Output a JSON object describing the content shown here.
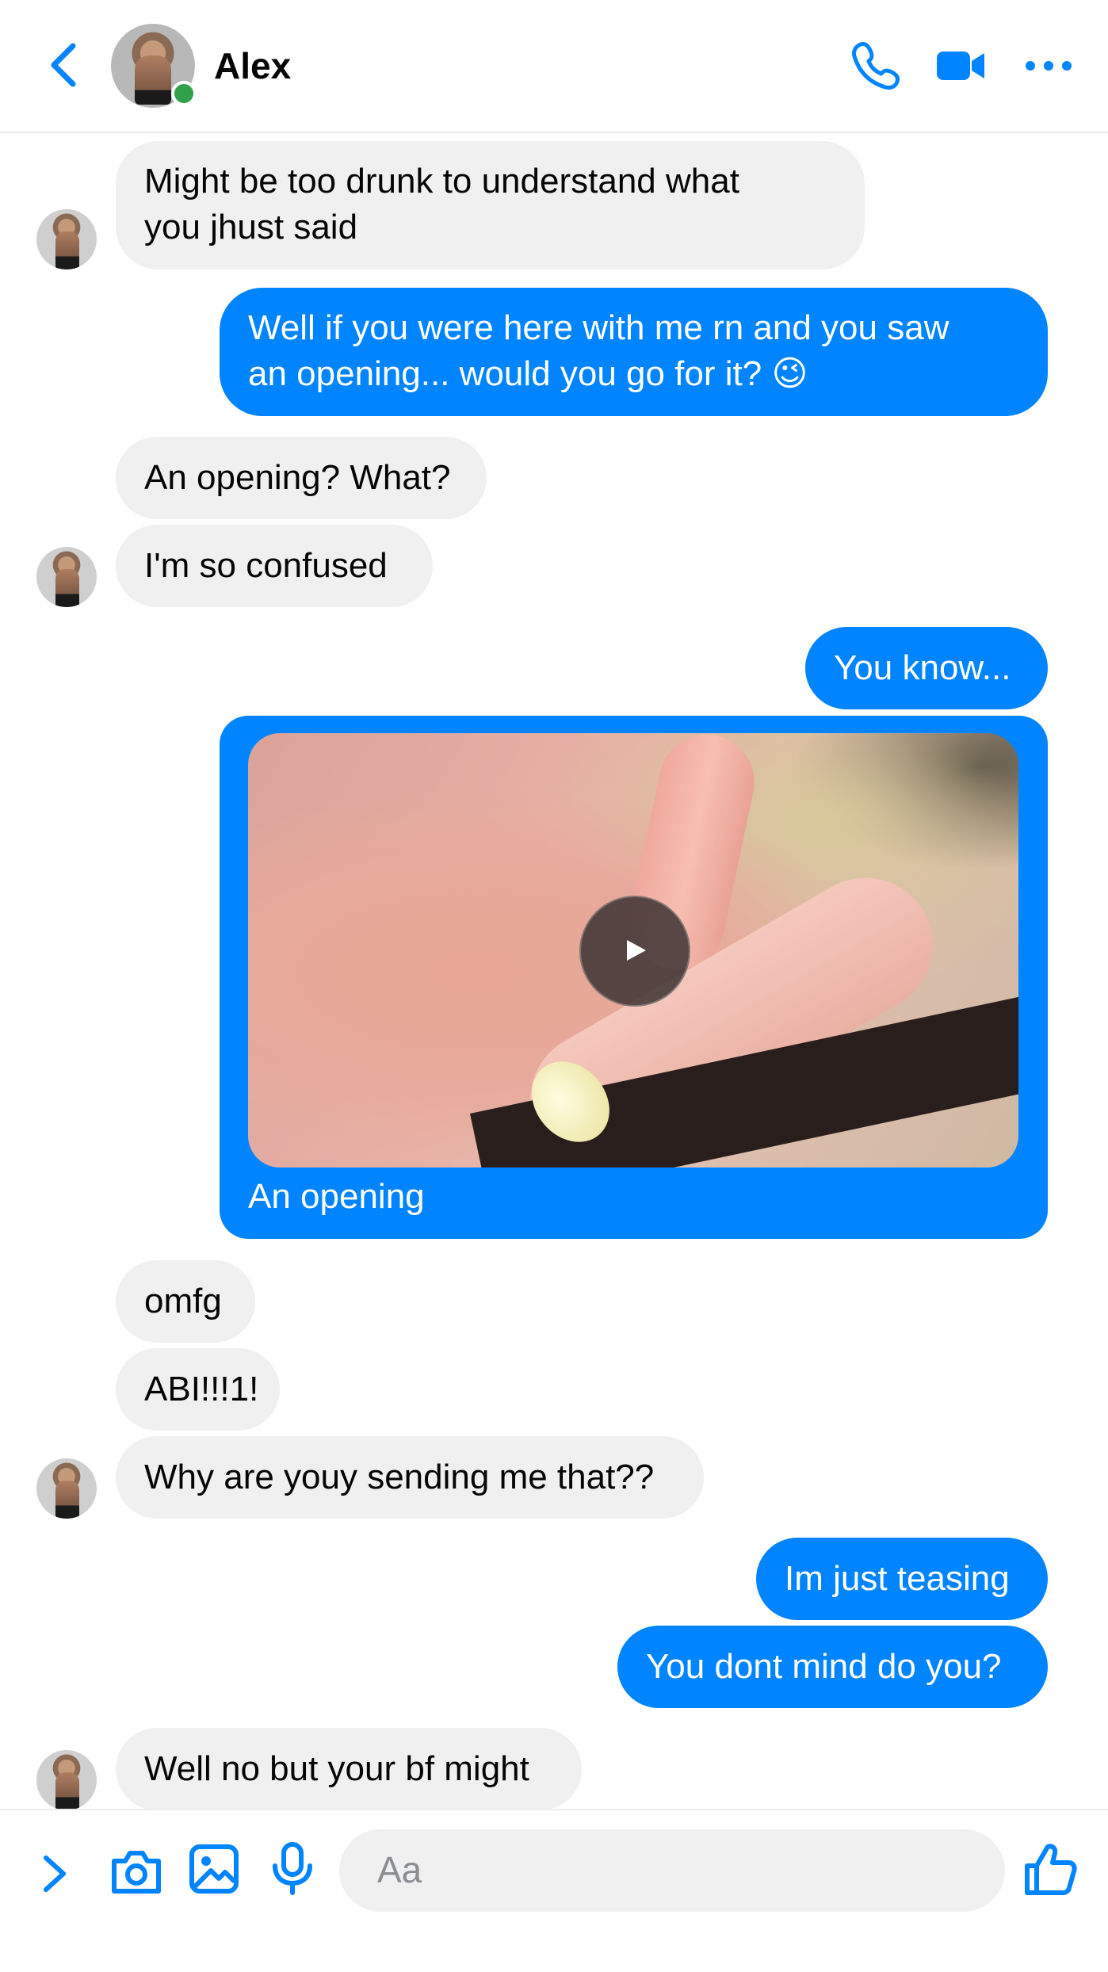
{
  "header": {
    "contact_name": "Alex",
    "online": true,
    "icons": [
      "back-chevron-icon",
      "phone-icon",
      "video-camera-icon",
      "more-dots-icon"
    ],
    "accent_color": "#0084ff"
  },
  "messages": [
    {
      "direction": "incoming",
      "lines": [
        "Might be too drunk to understand what",
        "you jhust said"
      ]
    },
    {
      "direction": "outgoing",
      "lines": [
        "Well if you were here with me rn and you saw",
        "an opening... would you go for it? 😉"
      ]
    },
    {
      "direction": "incoming",
      "lines": [
        "An opening? What?"
      ]
    },
    {
      "direction": "incoming",
      "lines": [
        "I'm so confused"
      ]
    },
    {
      "direction": "outgoing",
      "lines": [
        "You know..."
      ]
    },
    {
      "direction": "outgoing",
      "type": "video",
      "caption": "An opening"
    },
    {
      "direction": "incoming",
      "lines": [
        "omfg"
      ]
    },
    {
      "direction": "incoming",
      "lines": [
        "ABI!!!1!"
      ]
    },
    {
      "direction": "incoming",
      "lines": [
        "Why are youy sending me that??"
      ]
    },
    {
      "direction": "outgoing",
      "lines": [
        "Im just teasing"
      ]
    },
    {
      "direction": "outgoing",
      "lines": [
        "You dont mind do you?"
      ]
    },
    {
      "direction": "incoming",
      "lines": [
        "Well no but your bf might"
      ]
    }
  ],
  "composer": {
    "placeholder": "Aa",
    "icons": [
      "expand-chevron-icon",
      "camera-icon",
      "gallery-icon",
      "microphone-icon",
      "thumbs-up-icon"
    ]
  },
  "colors": {
    "outgoing_bubble": "#0084ff",
    "incoming_bubble": "#f0f0f0",
    "online_dot": "#31a24c"
  }
}
